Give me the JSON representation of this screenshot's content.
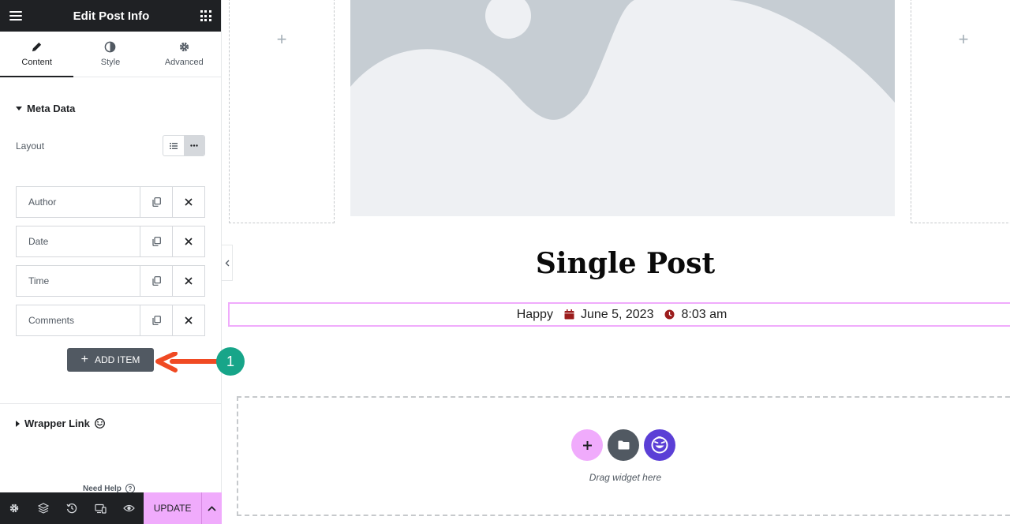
{
  "sidebar": {
    "title": "Edit Post Info",
    "tabs": [
      {
        "label": "Content",
        "icon": "pencil-icon",
        "active": true
      },
      {
        "label": "Style",
        "icon": "contrast-icon",
        "active": false
      },
      {
        "label": "Advanced",
        "icon": "gear-icon",
        "active": false
      }
    ],
    "meta_section": "Meta Data",
    "layout_label": "Layout",
    "layout_options": [
      "list-icon",
      "inline-icon"
    ],
    "items": [
      {
        "label": "Author"
      },
      {
        "label": "Date"
      },
      {
        "label": "Time"
      },
      {
        "label": "Comments"
      }
    ],
    "add_item_label": "ADD ITEM",
    "wrapper_section": "Wrapper Link",
    "need_help": "Need Help",
    "update_label": "UPDATE"
  },
  "canvas": {
    "post_title": "Single Post",
    "post_info": {
      "author": "Happy",
      "date": "June 5, 2023",
      "time": "8:03 am"
    },
    "drop_zone_text": "Drag widget here"
  },
  "annotation": {
    "step_number": "1"
  },
  "colors": {
    "dark": "#1f2124",
    "accent_pink": "#f0abfc",
    "step_green": "#17a589",
    "arrow_red": "#f04a23",
    "happy_purple": "#5b3fd6",
    "meta_icon_red": "#9b1c1c"
  }
}
